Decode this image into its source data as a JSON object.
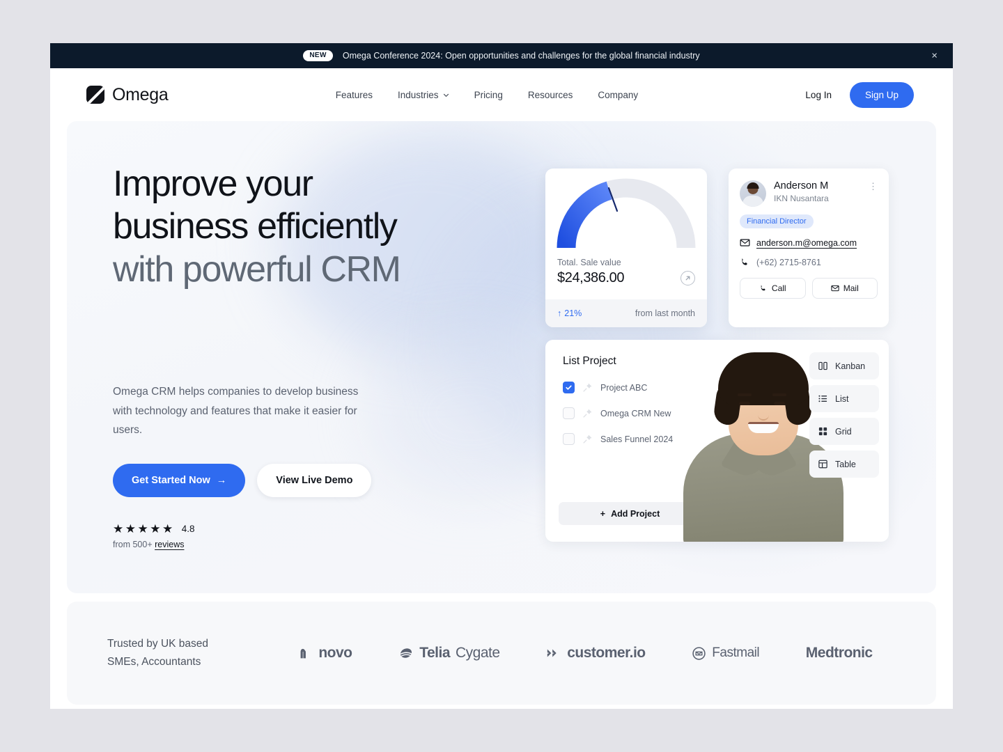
{
  "banner": {
    "badge": "NEW",
    "text": "Omega Conference 2024: Open opportunities and challenges for the global financial industry",
    "close": "×"
  },
  "nav": {
    "brand": "Omega",
    "links": [
      {
        "label": "Features",
        "dropdown": false
      },
      {
        "label": "Industries",
        "dropdown": true
      },
      {
        "label": "Pricing",
        "dropdown": false
      },
      {
        "label": "Resources",
        "dropdown": false
      },
      {
        "label": "Company",
        "dropdown": false
      }
    ],
    "login": "Log In",
    "signup": "Sign Up"
  },
  "hero": {
    "headline_line1": "Improve your",
    "headline_line2": "business efficiently",
    "headline_line3": "with powerful CRM",
    "subcopy": "Omega CRM helps companies to develop business with technology and features that make it easier for users.",
    "cta_primary": "Get Started Now",
    "cta_primary_arrow": "→",
    "cta_secondary": "View Live Demo",
    "stars": "★★★★★",
    "score": "4.8",
    "reviews_prefix": "from 500+ ",
    "reviews_link": "reviews"
  },
  "gauge_card": {
    "label": "Total. Sale value",
    "value": "$24,386.00",
    "delta_arrow": "↑",
    "delta": "21%",
    "delta_note": "from last month"
  },
  "chart_data": {
    "type": "gauge",
    "title": "Total. Sale value",
    "value": 24386.0,
    "value_label": "$24,386.00",
    "percent_filled": 40,
    "range_start_deg": 180,
    "range_end_deg": 360,
    "needle_deg": 252,
    "arc_color": "#2f5fe8",
    "arc_color_end": "#4f7bf5",
    "track_color": "#e7e9ef",
    "change_percent": 21,
    "change_direction": "up",
    "change_period": "from last month"
  },
  "contact_card": {
    "name": "Anderson M",
    "org": "IKN Nusantara",
    "kebab": "⋮",
    "role": "Financial Director",
    "email": "anderson.m@omega.com",
    "phone": "(+62) 2715-8761",
    "call_label": "Call",
    "mail_label": "Mail"
  },
  "project_card": {
    "title": "List Project",
    "items": [
      {
        "name": "Project ABC",
        "checked": true
      },
      {
        "name": "Omega CRM New",
        "checked": false
      },
      {
        "name": "Sales Funnel 2024",
        "checked": false
      }
    ],
    "add_label": "Add Project",
    "add_plus": "+",
    "views": [
      {
        "label": "Kanban",
        "icon": "kanban-icon"
      },
      {
        "label": "List",
        "icon": "list-icon"
      },
      {
        "label": "Grid",
        "icon": "grid-icon"
      },
      {
        "label": "Table",
        "icon": "table-icon"
      }
    ]
  },
  "trusted": {
    "text_line1": "Trusted by UK based",
    "text_line2": "SMEs, Accountants",
    "logos": [
      {
        "name": "novo"
      },
      {
        "name": "Telia",
        "name2": "Cygate"
      },
      {
        "name": "customer.io"
      },
      {
        "name": "Fastmail"
      },
      {
        "name": "Medtronic"
      }
    ]
  },
  "colors": {
    "accent": "#2f6bf0",
    "banner_bg": "#0c1a2b",
    "page_bg": "#e3e3e8",
    "hero_bg": "#f5f7fb"
  }
}
